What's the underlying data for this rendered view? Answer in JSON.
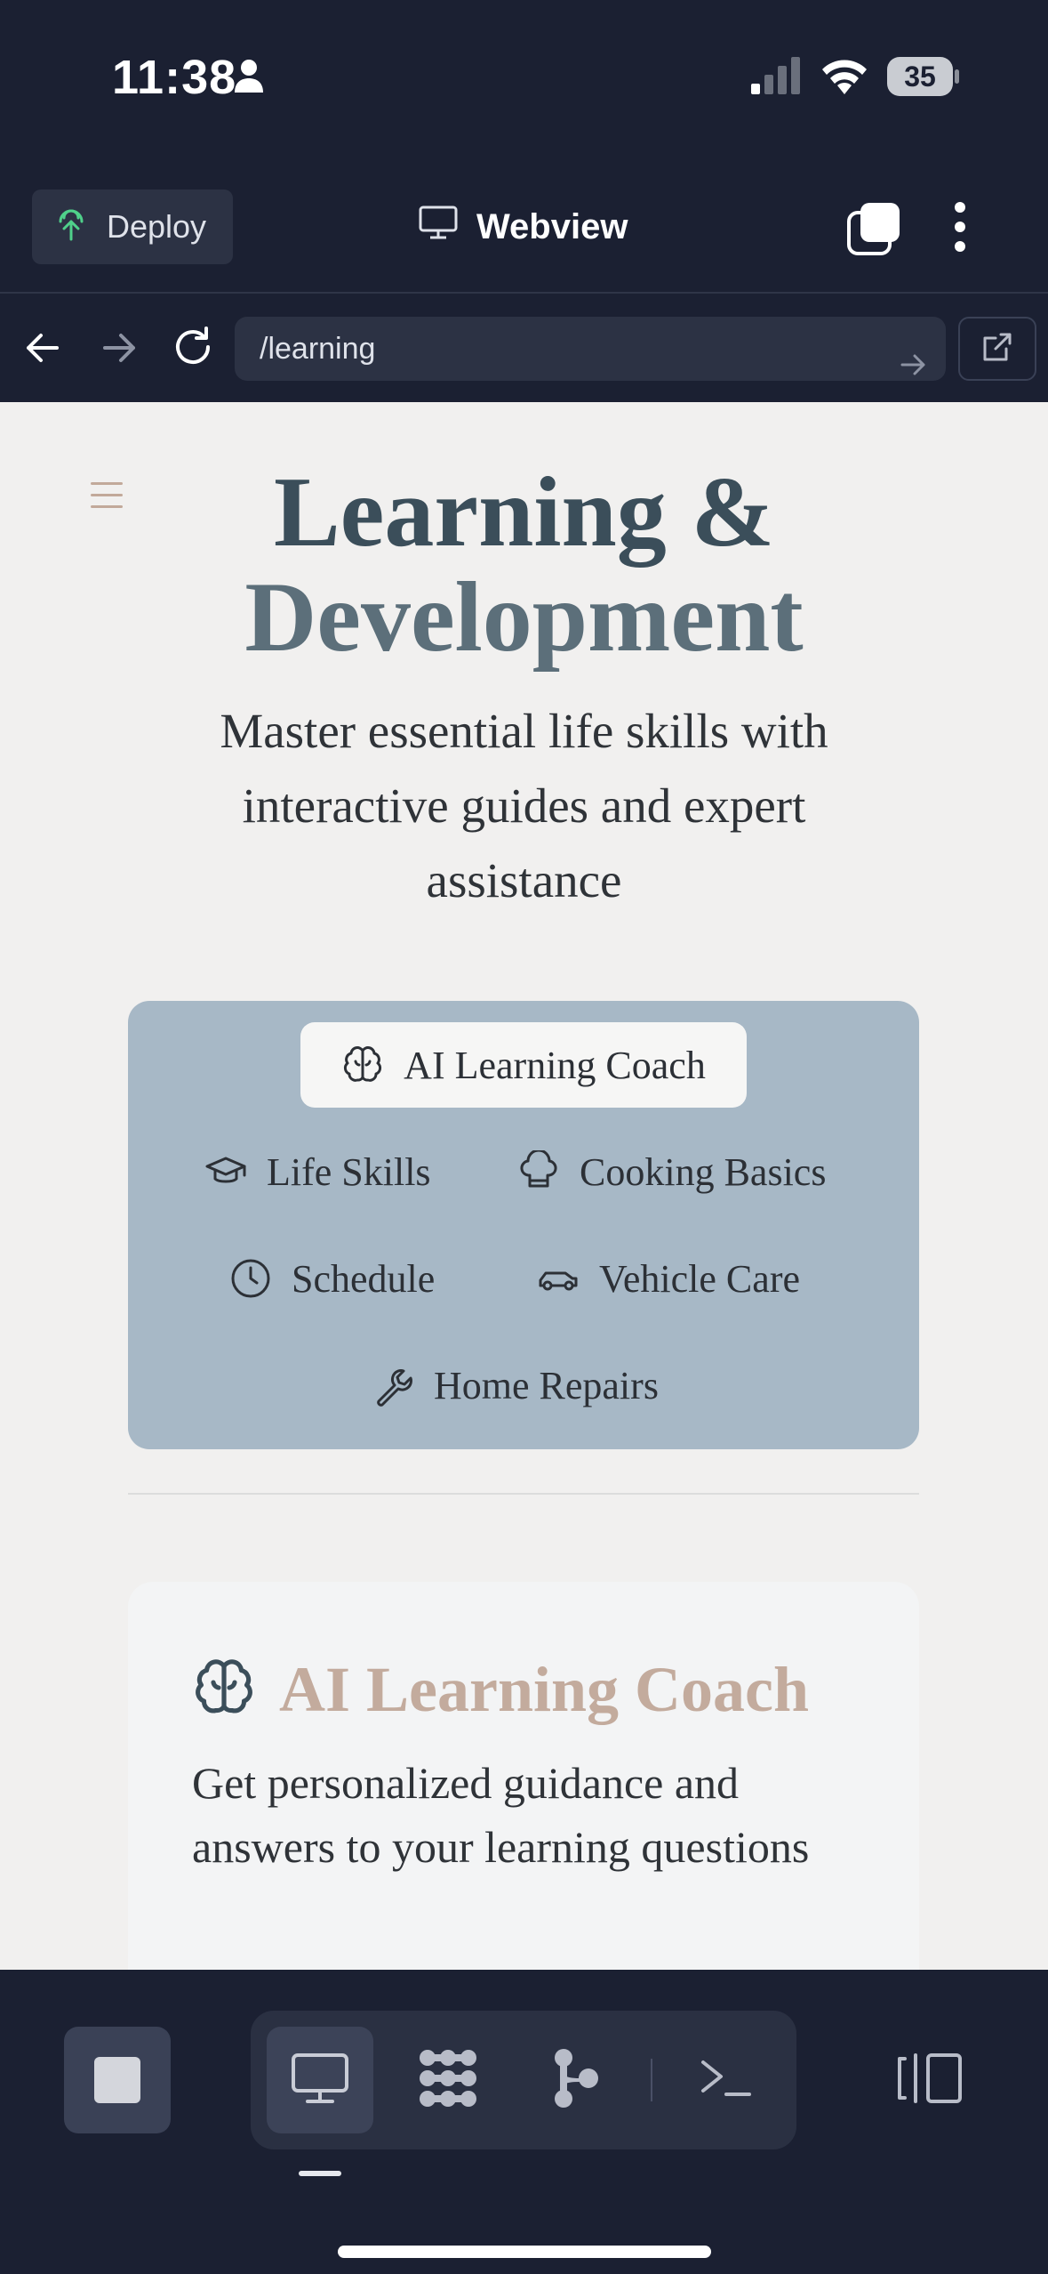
{
  "status_bar": {
    "time": "11:38",
    "battery": "35"
  },
  "toolbar": {
    "deploy_label": "Deploy",
    "title": "Webview"
  },
  "url_bar": {
    "url": "/learning"
  },
  "page": {
    "title_line1": "Learning &",
    "title_line2": "Development",
    "subtitle": "Master essential life skills with interactive guides and expert assistance",
    "tabs": [
      {
        "label": "AI Learning Coach",
        "icon": "brain-icon",
        "active": true
      },
      {
        "label": "Life Skills",
        "icon": "graduation-cap-icon"
      },
      {
        "label": "Cooking Basics",
        "icon": "chef-hat-icon"
      },
      {
        "label": "Schedule",
        "icon": "clock-icon"
      },
      {
        "label": "Vehicle Care",
        "icon": "car-icon"
      },
      {
        "label": "Home Repairs",
        "icon": "wrench-icon"
      }
    ],
    "card": {
      "title": "AI Learning Coach",
      "description": "Get personalized guidance and answers to your learning questions"
    }
  },
  "colors": {
    "app_background": "#1b2032",
    "tab_panel": "#a7b8c6",
    "card_title": "#c3ab9d",
    "page_title": "#3b4e5a"
  }
}
